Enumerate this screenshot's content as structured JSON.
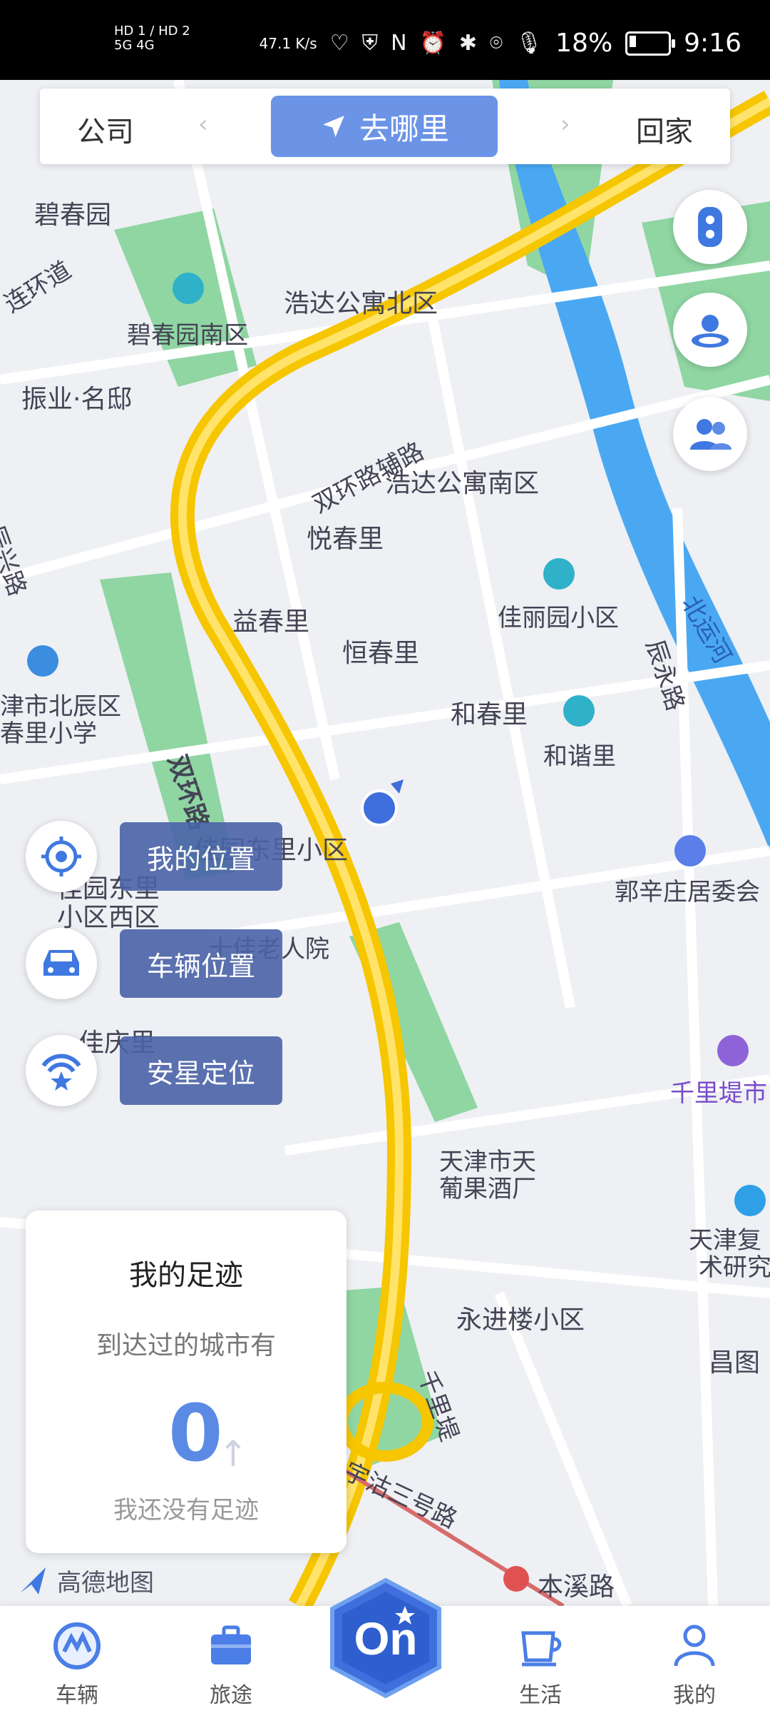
{
  "status_bar": {
    "sim_labels": "HD 1 / HD 2",
    "network": "5G 4G",
    "speed": "47.1 K/s",
    "battery": "18%",
    "time": "9:16"
  },
  "top_nav": {
    "left_label": "公司",
    "center_label": "去哪里",
    "right_label": "回家"
  },
  "map_labels": [
    {
      "text": "碧春园"
    },
    {
      "text": "连环道"
    },
    {
      "text": "碧春园南区"
    },
    {
      "text": "浩达公寓北区"
    },
    {
      "text": "振业·名邸"
    },
    {
      "text": "双环路辅路"
    },
    {
      "text": "浩达公寓南区"
    },
    {
      "text": "悦春里"
    },
    {
      "text": "益春里"
    },
    {
      "text": "恒春里"
    },
    {
      "text": "佳丽园小区"
    },
    {
      "text": "和春里"
    },
    {
      "text": "和谐里"
    },
    {
      "text": "双环路"
    },
    {
      "text": "津市北辰区"
    },
    {
      "text": "春里小学"
    },
    {
      "text": "佳园东里小区"
    },
    {
      "text": "佳园东里"
    },
    {
      "text": "小区西区"
    },
    {
      "text": "十佳老人院"
    },
    {
      "text": "郭辛庄居委会"
    },
    {
      "text": "佳庆里"
    },
    {
      "text": "千里堤市"
    },
    {
      "text": "天津市天"
    },
    {
      "text": "葡果酒厂"
    },
    {
      "text": "天津复"
    },
    {
      "text": "术研究"
    },
    {
      "text": "永进楼小区"
    },
    {
      "text": "昌图"
    },
    {
      "text": "千里堤"
    },
    {
      "text": "宇沽三号路"
    },
    {
      "text": "本溪路"
    },
    {
      "text": "辰永路"
    },
    {
      "text": "北运河"
    },
    {
      "text": "辰兴路"
    }
  ],
  "left_actions": {
    "my_location": "我的位置",
    "vehicle_location": "车辆位置",
    "anstar_locate": "安星定位"
  },
  "footprint_card": {
    "title": "我的足迹",
    "subtitle": "到达过的城市有",
    "count": "0",
    "hint": "我还没有足迹"
  },
  "map_attribution": "高德地图",
  "bottom_nav": {
    "tabs": [
      {
        "label": "车辆",
        "icon": "vehicle-icon"
      },
      {
        "label": "旅途",
        "icon": "suitcase-icon"
      },
      {
        "label": "On",
        "icon": "on-logo"
      },
      {
        "label": "生活",
        "icon": "cup-icon"
      },
      {
        "label": "我的",
        "icon": "person-icon"
      }
    ]
  },
  "colors": {
    "accent": "#6b93e6",
    "road_major": "#f6c600",
    "river": "#4aa8f2",
    "park": "#8fd6a2",
    "tag_bg": "#4a63a8"
  }
}
